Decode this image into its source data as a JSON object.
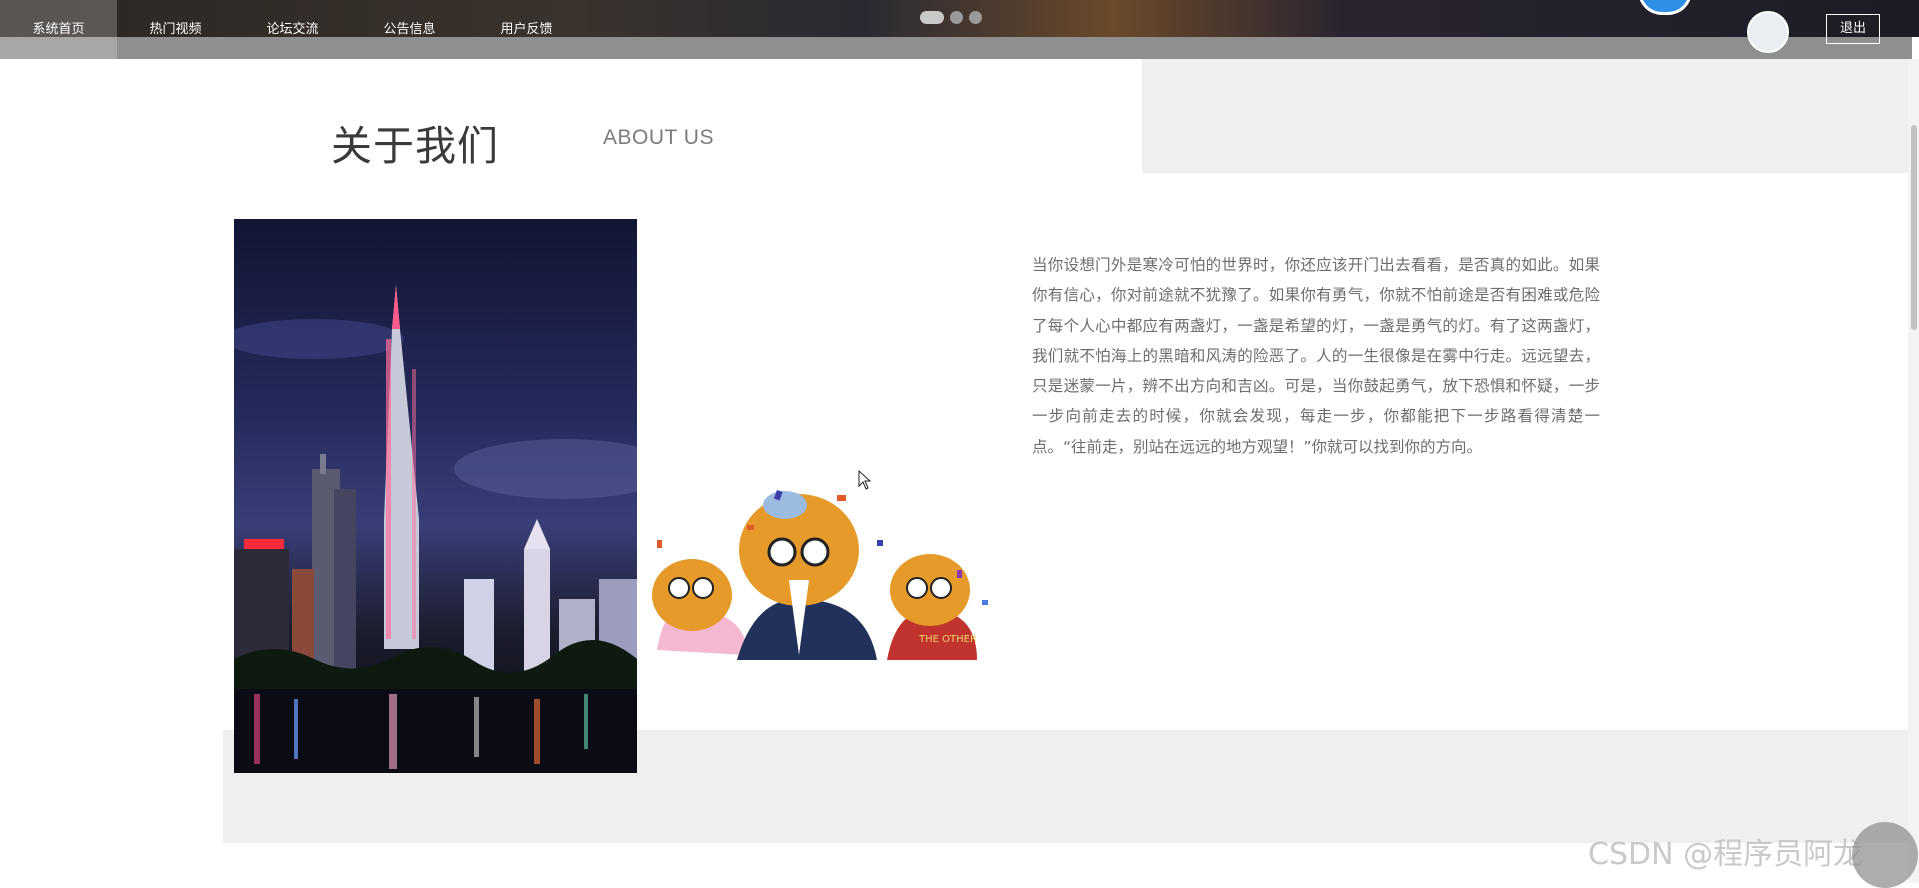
{
  "nav": {
    "items": [
      {
        "label": "系统首页",
        "active": true
      },
      {
        "label": "热门视频",
        "active": false
      },
      {
        "label": "论坛交流",
        "active": false
      },
      {
        "label": "公告信息",
        "active": false
      },
      {
        "label": "用户反馈",
        "active": false
      }
    ],
    "logout_label": "退出",
    "carousel": {
      "slide_count": 3,
      "active_index": 0
    }
  },
  "about": {
    "title_cn": "关于我们",
    "title_en": "ABOUT US",
    "paragraph": "当你设想门外是寒冷可怕的世界时，你还应该开门出去看看，是否真的如此。如果你有信心，你对前途就不犹豫了。如果你有勇气，你就不怕前途是否有困难或危险了每个人心中都应有两盏灯，一盏是希望的灯，一盏是勇气的灯。有了这两盏灯，我们就不怕海上的黑暗和风涛的险恶了。人的一生很像是在雾中行走。远远望去，只是迷蒙一片，辨不出方向和吉凶。可是，当你鼓起勇气，放下恐惧和怀疑，一步一步向前走去的时候，你就会发现，每走一步，你都能把下一步路看得清楚一点。“往前走，别站在远远的地方观望！”你就可以找到你的方向。"
  },
  "sticker_text": "THE OTHER",
  "watermark": "CSDN @程序员阿龙",
  "colors": {
    "accent_blue": "#2d8fe6",
    "text_gray": "#6d6d6d",
    "block_gray": "#efefef"
  }
}
